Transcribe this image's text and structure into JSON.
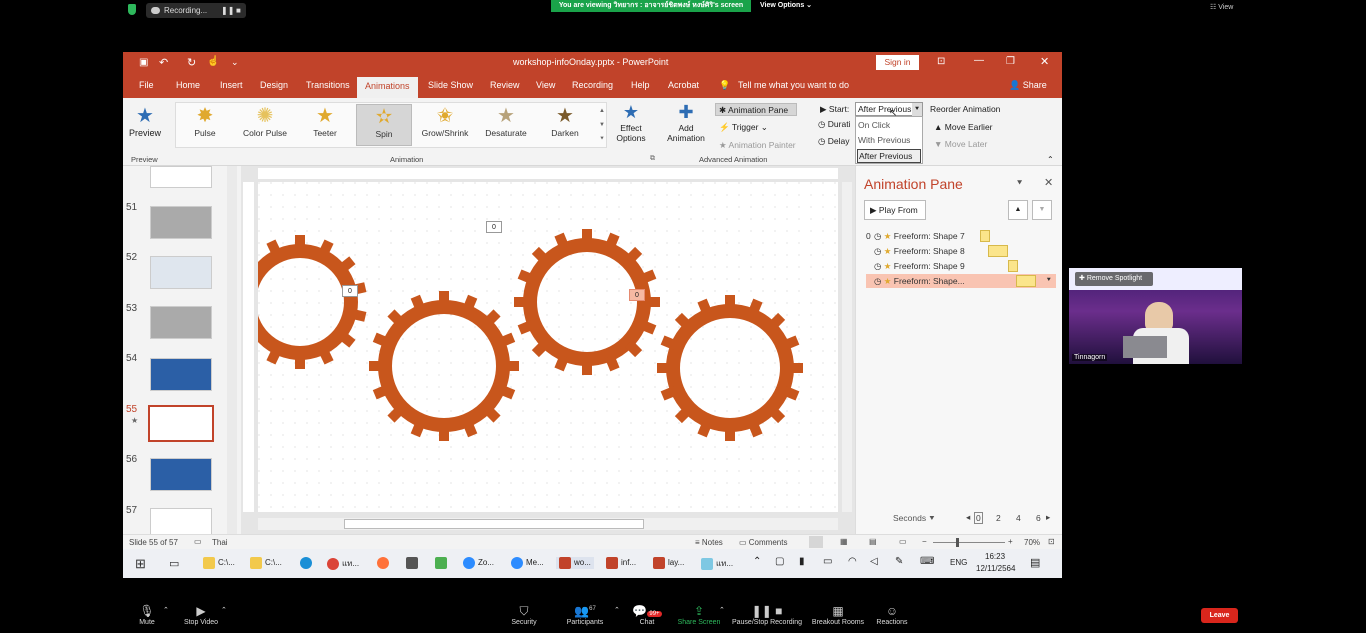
{
  "zoom_top": {
    "recording_label": "Recording...",
    "viewing_banner": "You are viewing วิทยากร : อาจารย์ชิตพงษ์ หงษ์ศิริ's screen",
    "view_options": "View Options",
    "view_button": "View"
  },
  "ppt": {
    "window_title": "workshop-infoOnday.pptx - PowerPoint",
    "sign_in": "Sign in",
    "tabs": [
      "File",
      "Home",
      "Insert",
      "Design",
      "Transitions",
      "Animations",
      "Slide Show",
      "Review",
      "View",
      "Recording",
      "Help",
      "Acrobat"
    ],
    "tell_me": "Tell me what you want to do",
    "share": "Share",
    "ribbon": {
      "preview_label": "Preview",
      "preview_group": "Preview",
      "animations": [
        "Pulse",
        "Color Pulse",
        "Teeter",
        "Spin",
        "Grow/Shrink",
        "Desaturate",
        "Darken"
      ],
      "effect_options": "Effect Options",
      "animation_group": "Animation",
      "add_animation": "Add Animation",
      "animation_pane_btn": "Animation Pane",
      "trigger": "Trigger",
      "animation_painter": "Animation Painter",
      "advanced_group": "Advanced Animation",
      "start_label": "Start:",
      "start_value": "After Previous",
      "start_options": [
        "On Click",
        "With Previous",
        "After Previous"
      ],
      "duration_label": "Durati",
      "delay_label": "Delay",
      "reorder_label": "Reorder Animation",
      "move_earlier": "Move Earlier",
      "move_later": "Move Later"
    },
    "thumbnails": [
      "51",
      "52",
      "53",
      "54",
      "55",
      "56",
      "57"
    ],
    "slide_tags": [
      "0",
      "0",
      "0"
    ],
    "pane": {
      "title": "Animation Pane",
      "play_from": "Play From",
      "items": [
        {
          "index": "0",
          "label": "Freeform: Shape 7"
        },
        {
          "index": "",
          "label": "Freeform: Shape 8"
        },
        {
          "index": "",
          "label": "Freeform: Shape 9"
        },
        {
          "index": "",
          "label": "Freeform: Shape..."
        }
      ],
      "seconds": "Seconds",
      "timeline": [
        "0",
        "2",
        "4",
        "6"
      ]
    },
    "status": {
      "slide_info": "Slide 55 of 57",
      "language": "Thai",
      "notes": "Notes",
      "comments": "Comments",
      "zoom": "70%"
    },
    "taskbar": {
      "apps": [
        "C:\\...",
        "C:\\...",
        "แท...",
        "Zo...",
        "Me...",
        "wo...",
        "inf...",
        "lay...",
        "แท..."
      ],
      "lang": "ENG",
      "time": "16:23",
      "date": "12/11/2564"
    }
  },
  "video": {
    "name": "Tinnagorn",
    "remove_spotlight": "Remove Spotlight"
  },
  "zoom_bottom": {
    "mute": "Mute",
    "stop_video": "Stop Video",
    "security": "Security",
    "participants": "Participants",
    "participants_count": "67",
    "chat": "Chat",
    "chat_badge": "99+",
    "share_screen": "Share Screen",
    "pause_recording": "Pause/Stop Recording",
    "breakout": "Breakout Rooms",
    "reactions": "Reactions",
    "leave": "Leave"
  },
  "colors": {
    "ppt_accent": "#c1432a",
    "gear": "#c8561c",
    "zoom_green": "#1aa34a",
    "leave_red": "#d9261c"
  }
}
